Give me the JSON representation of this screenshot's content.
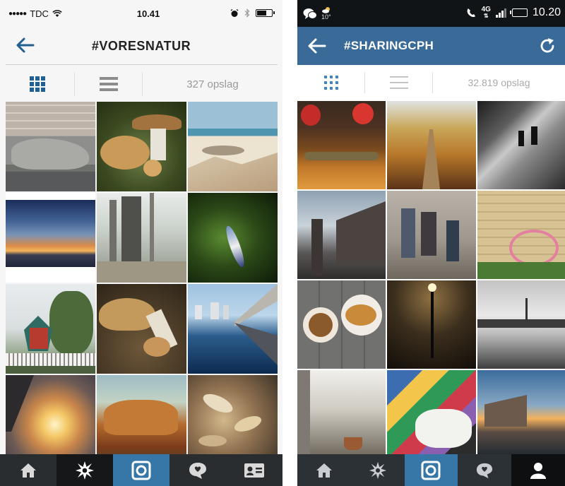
{
  "left": {
    "status": {
      "carrier": "TDC",
      "signal_dots": "●●●●●",
      "time": "10.41"
    },
    "title": "#VORESNATUR",
    "post_count": "327 opslag",
    "tabs": [
      "home-icon",
      "explore-icon",
      "camera-icon",
      "activity-icon",
      "profile-icon"
    ]
  },
  "right": {
    "status": {
      "weather": "10°",
      "network": "4G",
      "time": "10.20"
    },
    "title": "#SHARINGCPH",
    "post_count": "32.819 opslag",
    "tabs": [
      "home-icon",
      "explore-icon",
      "camera-icon",
      "activity-icon",
      "profile-icon"
    ]
  },
  "colors": {
    "ios_accent": "#1f5f92",
    "android_bar": "#3a6a98",
    "active_tab": "#3677a8"
  }
}
